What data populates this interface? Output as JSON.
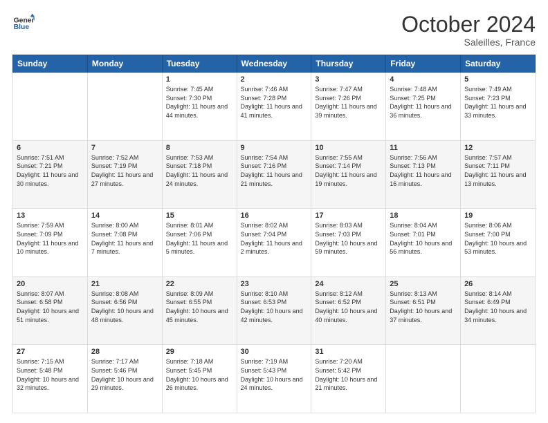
{
  "header": {
    "logo_line1": "General",
    "logo_line2": "Blue",
    "month": "October 2024",
    "location": "Saleilles, France"
  },
  "weekdays": [
    "Sunday",
    "Monday",
    "Tuesday",
    "Wednesday",
    "Thursday",
    "Friday",
    "Saturday"
  ],
  "weeks": [
    [
      {
        "day": "",
        "info": ""
      },
      {
        "day": "",
        "info": ""
      },
      {
        "day": "1",
        "info": "Sunrise: 7:45 AM\nSunset: 7:30 PM\nDaylight: 11 hours and 44 minutes."
      },
      {
        "day": "2",
        "info": "Sunrise: 7:46 AM\nSunset: 7:28 PM\nDaylight: 11 hours and 41 minutes."
      },
      {
        "day": "3",
        "info": "Sunrise: 7:47 AM\nSunset: 7:26 PM\nDaylight: 11 hours and 39 minutes."
      },
      {
        "day": "4",
        "info": "Sunrise: 7:48 AM\nSunset: 7:25 PM\nDaylight: 11 hours and 36 minutes."
      },
      {
        "day": "5",
        "info": "Sunrise: 7:49 AM\nSunset: 7:23 PM\nDaylight: 11 hours and 33 minutes."
      }
    ],
    [
      {
        "day": "6",
        "info": "Sunrise: 7:51 AM\nSunset: 7:21 PM\nDaylight: 11 hours and 30 minutes."
      },
      {
        "day": "7",
        "info": "Sunrise: 7:52 AM\nSunset: 7:19 PM\nDaylight: 11 hours and 27 minutes."
      },
      {
        "day": "8",
        "info": "Sunrise: 7:53 AM\nSunset: 7:18 PM\nDaylight: 11 hours and 24 minutes."
      },
      {
        "day": "9",
        "info": "Sunrise: 7:54 AM\nSunset: 7:16 PM\nDaylight: 11 hours and 21 minutes."
      },
      {
        "day": "10",
        "info": "Sunrise: 7:55 AM\nSunset: 7:14 PM\nDaylight: 11 hours and 19 minutes."
      },
      {
        "day": "11",
        "info": "Sunrise: 7:56 AM\nSunset: 7:13 PM\nDaylight: 11 hours and 16 minutes."
      },
      {
        "day": "12",
        "info": "Sunrise: 7:57 AM\nSunset: 7:11 PM\nDaylight: 11 hours and 13 minutes."
      }
    ],
    [
      {
        "day": "13",
        "info": "Sunrise: 7:59 AM\nSunset: 7:09 PM\nDaylight: 11 hours and 10 minutes."
      },
      {
        "day": "14",
        "info": "Sunrise: 8:00 AM\nSunset: 7:08 PM\nDaylight: 11 hours and 7 minutes."
      },
      {
        "day": "15",
        "info": "Sunrise: 8:01 AM\nSunset: 7:06 PM\nDaylight: 11 hours and 5 minutes."
      },
      {
        "day": "16",
        "info": "Sunrise: 8:02 AM\nSunset: 7:04 PM\nDaylight: 11 hours and 2 minutes."
      },
      {
        "day": "17",
        "info": "Sunrise: 8:03 AM\nSunset: 7:03 PM\nDaylight: 10 hours and 59 minutes."
      },
      {
        "day": "18",
        "info": "Sunrise: 8:04 AM\nSunset: 7:01 PM\nDaylight: 10 hours and 56 minutes."
      },
      {
        "day": "19",
        "info": "Sunrise: 8:06 AM\nSunset: 7:00 PM\nDaylight: 10 hours and 53 minutes."
      }
    ],
    [
      {
        "day": "20",
        "info": "Sunrise: 8:07 AM\nSunset: 6:58 PM\nDaylight: 10 hours and 51 minutes."
      },
      {
        "day": "21",
        "info": "Sunrise: 8:08 AM\nSunset: 6:56 PM\nDaylight: 10 hours and 48 minutes."
      },
      {
        "day": "22",
        "info": "Sunrise: 8:09 AM\nSunset: 6:55 PM\nDaylight: 10 hours and 45 minutes."
      },
      {
        "day": "23",
        "info": "Sunrise: 8:10 AM\nSunset: 6:53 PM\nDaylight: 10 hours and 42 minutes."
      },
      {
        "day": "24",
        "info": "Sunrise: 8:12 AM\nSunset: 6:52 PM\nDaylight: 10 hours and 40 minutes."
      },
      {
        "day": "25",
        "info": "Sunrise: 8:13 AM\nSunset: 6:51 PM\nDaylight: 10 hours and 37 minutes."
      },
      {
        "day": "26",
        "info": "Sunrise: 8:14 AM\nSunset: 6:49 PM\nDaylight: 10 hours and 34 minutes."
      }
    ],
    [
      {
        "day": "27",
        "info": "Sunrise: 7:15 AM\nSunset: 5:48 PM\nDaylight: 10 hours and 32 minutes."
      },
      {
        "day": "28",
        "info": "Sunrise: 7:17 AM\nSunset: 5:46 PM\nDaylight: 10 hours and 29 minutes."
      },
      {
        "day": "29",
        "info": "Sunrise: 7:18 AM\nSunset: 5:45 PM\nDaylight: 10 hours and 26 minutes."
      },
      {
        "day": "30",
        "info": "Sunrise: 7:19 AM\nSunset: 5:43 PM\nDaylight: 10 hours and 24 minutes."
      },
      {
        "day": "31",
        "info": "Sunrise: 7:20 AM\nSunset: 5:42 PM\nDaylight: 10 hours and 21 minutes."
      },
      {
        "day": "",
        "info": ""
      },
      {
        "day": "",
        "info": ""
      }
    ]
  ]
}
